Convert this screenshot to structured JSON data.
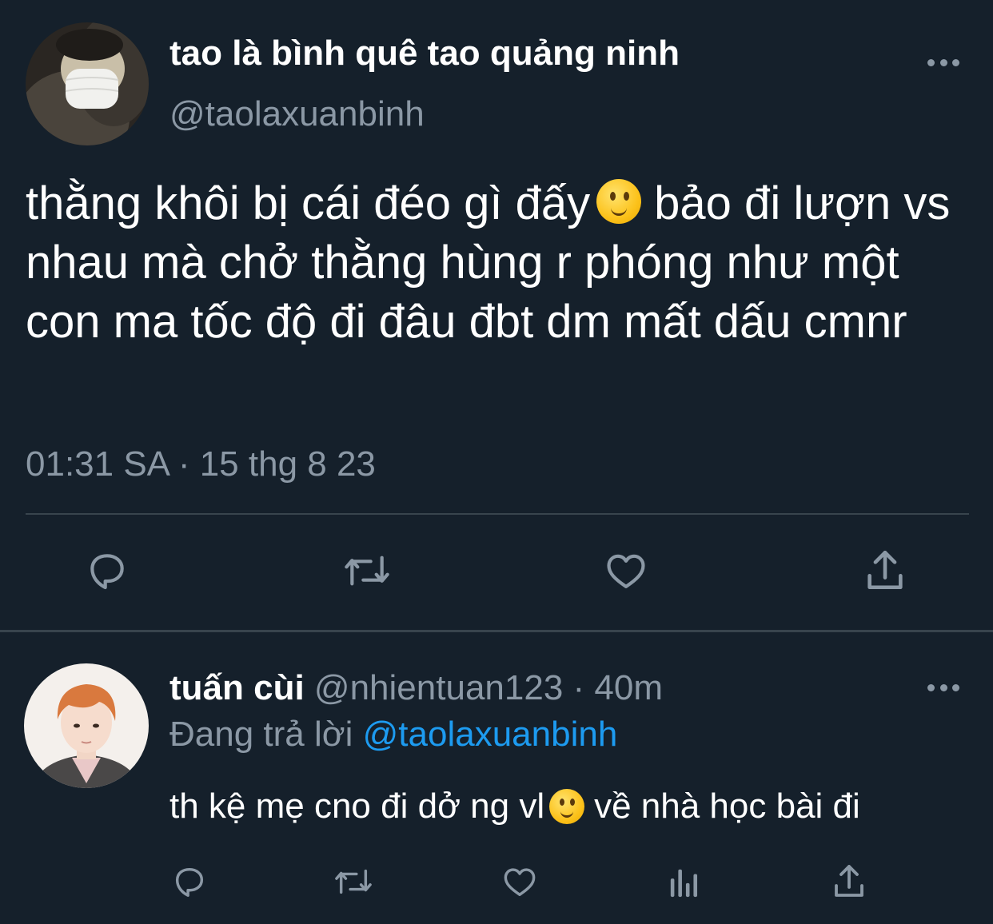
{
  "main_tweet": {
    "display_name": "tao là bình quê tao quảng ninh",
    "handle": "@taolaxuanbinh",
    "text_before_emoji": "thằng khôi bị cái đéo gì đấy",
    "text_after_emoji": "bảo đi lượn vs nhau mà chở thằng hùng r phóng như một con ma tốc độ đi đâu đbt dm mất dấu cmnr",
    "timestamp": "01:31 SA · 15 thg 8 23",
    "actions": [
      "reply-icon",
      "retweet-icon",
      "like-icon",
      "share-icon"
    ]
  },
  "reply_tweet": {
    "display_name": "tuấn cùi",
    "handle": "@nhientuan123",
    "time": "· 40m",
    "replying_label": "Đang trả lời",
    "replying_to": "@taolaxuanbinh",
    "text_before_emoji": "th kệ mẹ cno đi dở ng vl",
    "text_after_emoji": "về nhà học bài đi",
    "actions": [
      "reply-icon",
      "retweet-icon",
      "like-icon",
      "analytics-icon",
      "share-icon"
    ]
  },
  "colors": {
    "background": "#15202b",
    "secondary_text": "#8b98a5",
    "link": "#1d9bf0",
    "divider": "#38444d"
  }
}
